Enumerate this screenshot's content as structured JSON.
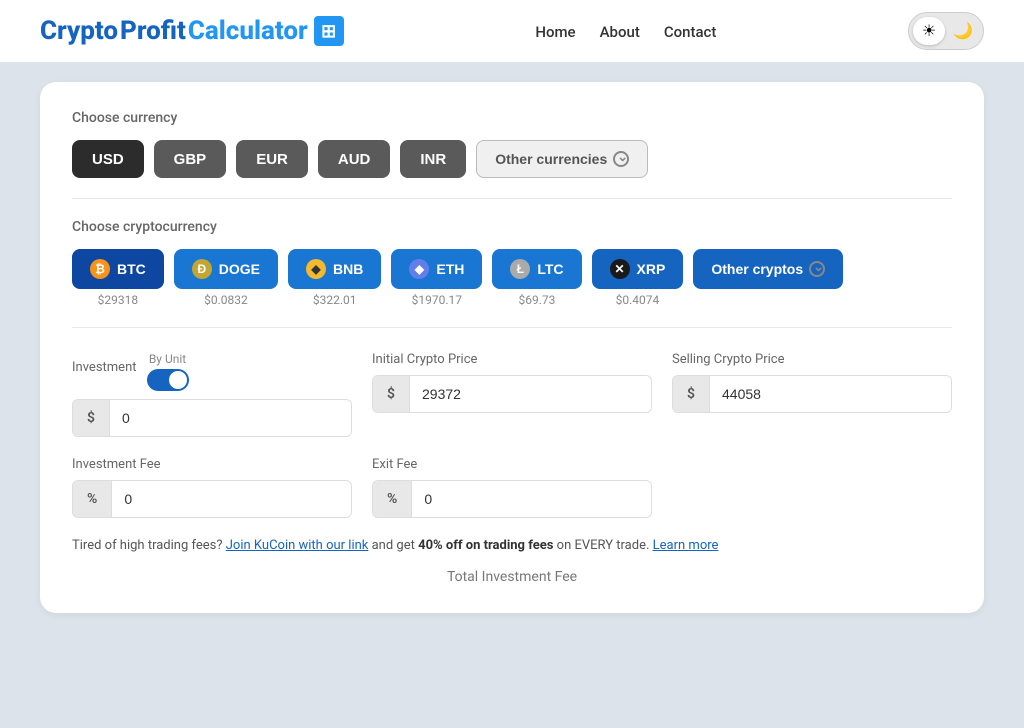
{
  "nav": {
    "logo_crypto": "Crypto",
    "logo_profit": "Profit",
    "logo_calculator": "Calculator",
    "logo_icon": "▦",
    "links": [
      {
        "label": "Home",
        "id": "home"
      },
      {
        "label": "About",
        "id": "about"
      },
      {
        "label": "Contact",
        "id": "contact"
      }
    ],
    "theme_light_icon": "☀",
    "theme_dark_icon": "🌙"
  },
  "currency": {
    "section_label": "Choose currency",
    "buttons": [
      {
        "label": "USD",
        "active": true
      },
      {
        "label": "GBP",
        "active": false
      },
      {
        "label": "EUR",
        "active": false
      },
      {
        "label": "AUD",
        "active": false
      },
      {
        "label": "INR",
        "active": false
      }
    ],
    "other_label": "Other currencies"
  },
  "crypto": {
    "section_label": "Choose cryptocurrency",
    "coins": [
      {
        "id": "btc",
        "label": "BTC",
        "icon": "₿",
        "icon_class": "coin-btc",
        "price": "$29318",
        "selected": true
      },
      {
        "id": "doge",
        "label": "DOGE",
        "icon": "Ð",
        "icon_class": "coin-doge",
        "price": "$0.0832",
        "selected": false
      },
      {
        "id": "bnb",
        "label": "BNB",
        "icon": "◆",
        "icon_class": "coin-bnb",
        "price": "$322.01",
        "selected": false
      },
      {
        "id": "eth",
        "label": "ETH",
        "icon": "◆",
        "icon_class": "coin-eth",
        "price": "$1970.17",
        "selected": false
      },
      {
        "id": "ltc",
        "label": "LTC",
        "icon": "Ł",
        "icon_class": "coin-ltc",
        "price": "$69.73",
        "selected": false
      },
      {
        "id": "xrp",
        "label": "XRP",
        "icon": "✕",
        "icon_class": "coin-xrp",
        "price": "$0.4074",
        "selected": false
      }
    ],
    "other_label": "Other cryptos"
  },
  "investment": {
    "label": "Investment",
    "by_unit_label": "By Unit",
    "prefix": "$",
    "value": "0"
  },
  "initial_price": {
    "label": "Initial Crypto Price",
    "prefix": "$",
    "value": "29372"
  },
  "selling_price": {
    "label": "Selling Crypto Price",
    "prefix": "$",
    "value": "44058"
  },
  "investment_fee": {
    "label": "Investment Fee",
    "prefix": "%",
    "value": "0"
  },
  "exit_fee": {
    "label": "Exit Fee",
    "prefix": "%",
    "value": "0"
  },
  "promo": {
    "text_before": "Tired of high trading fees?",
    "link_text": "Join KuCoin with our link",
    "text_middle": "and get",
    "highlight": "40% off on trading fees",
    "text_after": "on EVERY trade.",
    "learn_more": "Learn more"
  },
  "total_label": "Total Investment Fee"
}
